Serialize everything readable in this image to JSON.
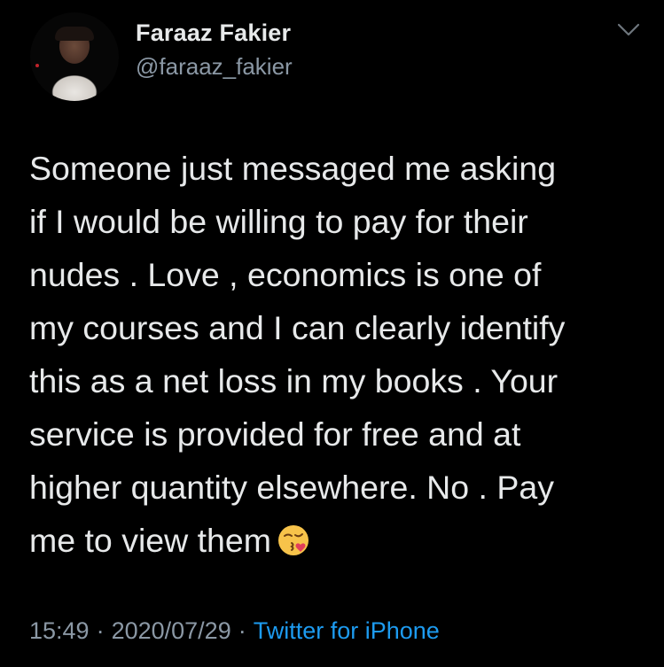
{
  "author": {
    "display_name": "Faraaz Fakier",
    "handle": "@faraaz_fakier"
  },
  "tweet": {
    "text": "Someone just messaged me asking\nif I would be willing to pay for their\nnudes . Love , economics is one of\nmy courses and I can clearly identify\nthis as a net loss in my books . Your\nservice is provided for free and at\nhigher quantity elsewhere. No . Pay\nme to view them",
    "emoji": "kissing-face-with-heart-emoji",
    "time": "15:49",
    "date": "2020/07/29",
    "separator": "·",
    "source": "Twitter for iPhone"
  },
  "colors": {
    "background": "#000000",
    "primary_text": "#e7e9ea",
    "secondary_text": "#8b98a5",
    "link": "#1d9bf0"
  }
}
